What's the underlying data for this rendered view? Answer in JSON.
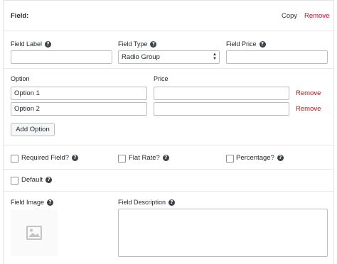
{
  "header": {
    "title": "Field:",
    "copy_label": "Copy",
    "remove_label": "Remove"
  },
  "field_label": {
    "label": "Field Label",
    "value": ""
  },
  "field_type": {
    "label": "Field Type",
    "value": "Radio Group"
  },
  "field_price": {
    "label": "Field Price",
    "value": ""
  },
  "options": {
    "option_header": "Option",
    "price_header": "Price",
    "rows": [
      {
        "option": "Option 1",
        "price": "",
        "remove_label": "Remove"
      },
      {
        "option": "Option 2",
        "price": "",
        "remove_label": "Remove"
      }
    ],
    "add_label": "Add Option"
  },
  "checkboxes": {
    "required": {
      "label": "Required Field?",
      "checked": false
    },
    "flat_rate": {
      "label": "Flat Rate?",
      "checked": false
    },
    "percentage": {
      "label": "Percentage?",
      "checked": false
    },
    "default": {
      "label": "Default",
      "checked": false
    }
  },
  "field_image": {
    "label": "Field Image",
    "icon": "image-placeholder-icon"
  },
  "field_description": {
    "label": "Field Description",
    "value": ""
  },
  "help_icon": {
    "glyph": "?"
  },
  "colors": {
    "remove": "#c0111f",
    "border": "#b9bdc2",
    "help_bg": "#3c434a"
  }
}
